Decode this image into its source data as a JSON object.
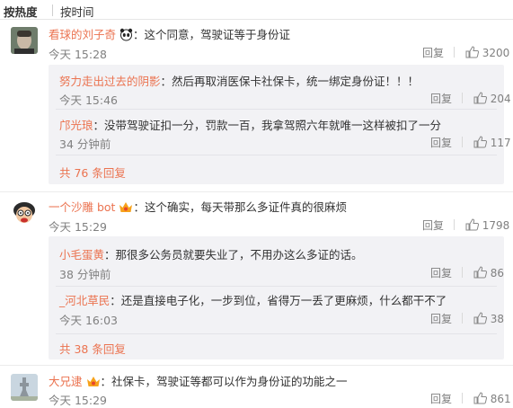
{
  "sort": {
    "hot": "按热度",
    "time": "按时间"
  },
  "comments": [
    {
      "name": "看球的刘子奇",
      "text": "：这个同意，驾驶证等于身份证",
      "time": "今天 15:28",
      "reply": "回复",
      "likes": "3200",
      "replies": [
        {
          "name": "努力走出过去的阴影",
          "text": "：然后再取消医保卡社保卡，统一绑定身份证！！！",
          "time": "今天 15:46",
          "reply": "回复",
          "likes": "204"
        },
        {
          "name": "邝光琅",
          "text": "：没带驾驶证扣一分，罚款一百，我拿驾照六年就唯一这样被扣了一分",
          "time": "34 分钟前",
          "reply": "回复",
          "likes": "117"
        }
      ],
      "more": "共 76 条回复"
    },
    {
      "name": "一个沙雕 bot",
      "text": "：这个确实，每天带那么多证件真的很麻烦",
      "time": "今天 15:29",
      "reply": "回复",
      "likes": "1798",
      "replies": [
        {
          "name": "小毛蛋黄",
          "text": "：那很多公务员就要失业了，不用办这么多证的话。",
          "time": "38 分钟前",
          "reply": "回复",
          "likes": "86"
        },
        {
          "name": "_河北草民",
          "text": "：还是直接电子化，一步到位，省得万一丢了更麻烦，什么都干不了",
          "time": "今天 16:03",
          "reply": "回复",
          "likes": "38"
        }
      ],
      "more": "共 38 条回复"
    },
    {
      "name": "大兄逮",
      "text": "：社保卡，驾驶证等都可以作为身份证的功能之一",
      "time": "今天 15:29",
      "reply": "回复",
      "likes": "861"
    }
  ]
}
